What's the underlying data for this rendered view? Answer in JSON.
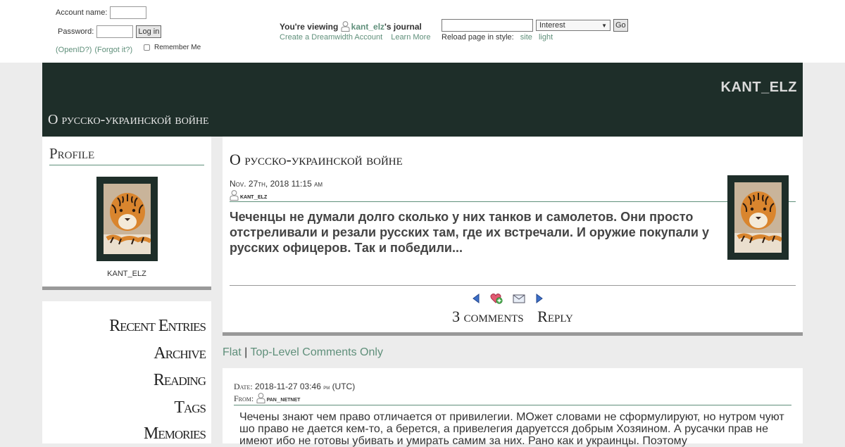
{
  "login": {
    "account_label": "Account name:",
    "password_label": "Password:",
    "login_button": "Log in",
    "openid": "(OpenID?)",
    "forgot": "(Forgot it?)",
    "remember": "Remember Me"
  },
  "viewing": {
    "prefix": "You're viewing",
    "user": "kant_elz",
    "suffix": "'s journal",
    "create": "Create a Dreamwidth Account",
    "learn": "Learn More"
  },
  "search": {
    "select_value": "Interest",
    "go": "Go",
    "reload_label": "Reload page in style:",
    "style_site": "site",
    "style_light": "light"
  },
  "header": {
    "journal_name": "KANT_ELZ",
    "journal_title": "О русско-украинской войне"
  },
  "profile": {
    "heading": "Profile",
    "username": "KANT_ELZ"
  },
  "nav": {
    "items": [
      "Recent Entries",
      "Archive",
      "Reading",
      "Tags",
      "Memories"
    ]
  },
  "entry": {
    "title": "О русско-украинской войне",
    "date": "Nov. 27th, 2018 11:15 am",
    "poster": "kant_elz",
    "body": " Чеченцы не думали долго сколько у них танков и самолетов. Они просто отстреливали и резали русских там, где их встречали. И оружие покупали у русских офицеров. Так и победили...",
    "comments_link": "3 comments",
    "reply_link": "Reply"
  },
  "view_options": {
    "flat": "Flat",
    "separator": "|",
    "top_level": "Top-Level Comments Only"
  },
  "comment": {
    "date_label": "Date:",
    "date_value": "2018-11-27 03:46",
    "date_ampm": "pm",
    "date_tz": "(UTC)",
    "from_label": "From:",
    "from_user": "pan_netnet",
    "body": "Чечены знают чем право отличается от привилегии. МОжет словами не сформулируют, но нутром чуют шо право не дается кем-то, а берется, а привелегия даруетсся добрым Хозяином. А русачки прав не имеют ибо не готовы убивать и умирать самим за них. Рано как и украинцы. Поэтому"
  },
  "colors": {
    "header_bg": "#1e2e29",
    "link": "#5f8f7a",
    "page_bg": "#ececec"
  }
}
